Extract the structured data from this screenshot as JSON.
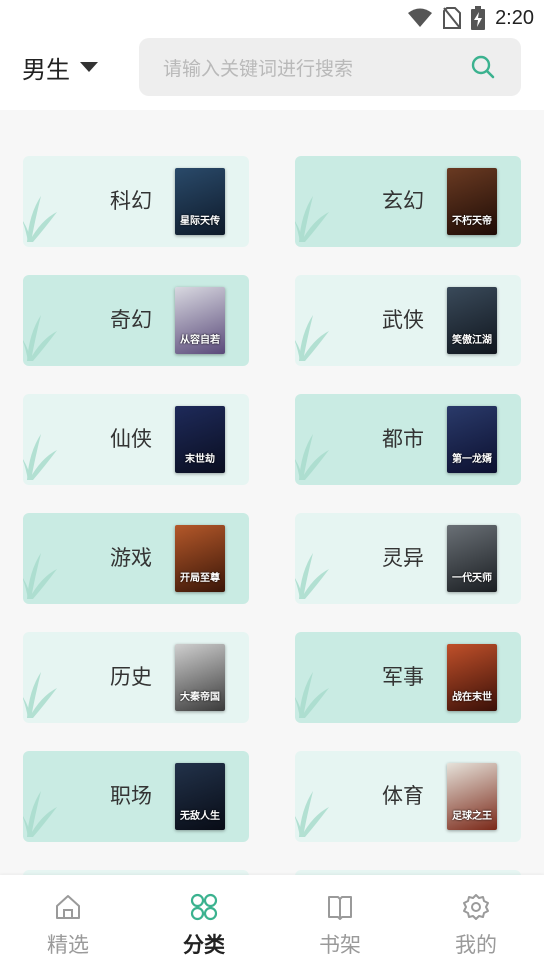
{
  "status": {
    "time": "2:20"
  },
  "header": {
    "gender": "男生",
    "search_placeholder": "请输入关键词进行搜索"
  },
  "categories": [
    {
      "name": "科幻",
      "cover": "星际天传",
      "variant": "light",
      "cover_colors": [
        "#2a4a6a",
        "#0e1a2a"
      ]
    },
    {
      "name": "玄幻",
      "cover": "不朽天帝",
      "variant": "dark",
      "cover_colors": [
        "#6a3a22",
        "#1e0c06"
      ]
    },
    {
      "name": "奇幻",
      "cover": "从容自若",
      "variant": "dark",
      "cover_colors": [
        "#d8d8e0",
        "#5a4a7a"
      ]
    },
    {
      "name": "武侠",
      "cover": "笑傲江湖",
      "variant": "light",
      "cover_colors": [
        "#3a4a5a",
        "#10161e"
      ]
    },
    {
      "name": "仙侠",
      "cover": "末世劫",
      "variant": "light",
      "cover_colors": [
        "#1e2a5a",
        "#0a0e20"
      ]
    },
    {
      "name": "都市",
      "cover": "第一龙婿",
      "variant": "dark",
      "cover_colors": [
        "#2a3a6a",
        "#0c1030"
      ]
    },
    {
      "name": "游戏",
      "cover": "开局至尊",
      "variant": "dark",
      "cover_colors": [
        "#b4582a",
        "#3a1608"
      ]
    },
    {
      "name": "灵异",
      "cover": "一代天师",
      "variant": "light",
      "cover_colors": [
        "#6a7076",
        "#1a1e22"
      ]
    },
    {
      "name": "历史",
      "cover": "大秦帝国",
      "variant": "light",
      "cover_colors": [
        "#cfcfcf",
        "#3a3a3a"
      ]
    },
    {
      "name": "军事",
      "cover": "战在末世",
      "variant": "dark",
      "cover_colors": [
        "#c0502a",
        "#3a1008"
      ]
    },
    {
      "name": "职场",
      "cover": "无敌人生",
      "variant": "dark",
      "cover_colors": [
        "#22324a",
        "#080c16"
      ]
    },
    {
      "name": "体育",
      "cover": "足球之王",
      "variant": "light",
      "cover_colors": [
        "#e6e2da",
        "#7a2818"
      ]
    }
  ],
  "tabs": [
    {
      "label": "精选",
      "icon": "home-icon",
      "active": false
    },
    {
      "label": "分类",
      "icon": "category-icon",
      "active": true
    },
    {
      "label": "书架",
      "icon": "bookshelf-icon",
      "active": false
    },
    {
      "label": "我的",
      "icon": "gear-icon",
      "active": false
    }
  ],
  "colors": {
    "accent": "#3bb28f",
    "card_light": "#e6f5f2",
    "card_dark": "#c9ebe3"
  }
}
